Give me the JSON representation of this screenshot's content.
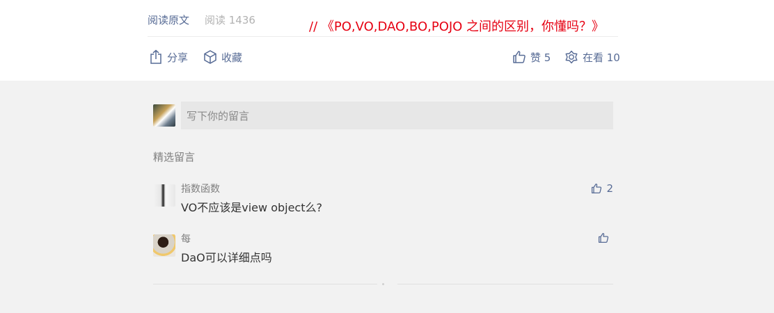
{
  "article": {
    "read_original": "阅读原文",
    "read_count": "阅读 1436",
    "annotation": "// 《PO,VO,DAO,BO,POJO 之间的区别，你懂吗？》"
  },
  "actions": {
    "share": "分享",
    "favorite": "收藏",
    "like": "赞 5",
    "watching": "在看 10"
  },
  "comment_box": {
    "placeholder": "写下你的留言"
  },
  "comments_section": {
    "title": "精选留言",
    "items": [
      {
        "name": "指数函数",
        "text": "VO不应该是view object么?",
        "likes": "2"
      },
      {
        "name": "每",
        "text": "DaO可以详细点吗",
        "likes": ""
      }
    ]
  },
  "colors": {
    "link": "#576b95",
    "annotation": "#e60012",
    "gray_bg": "#f2f2f2"
  }
}
